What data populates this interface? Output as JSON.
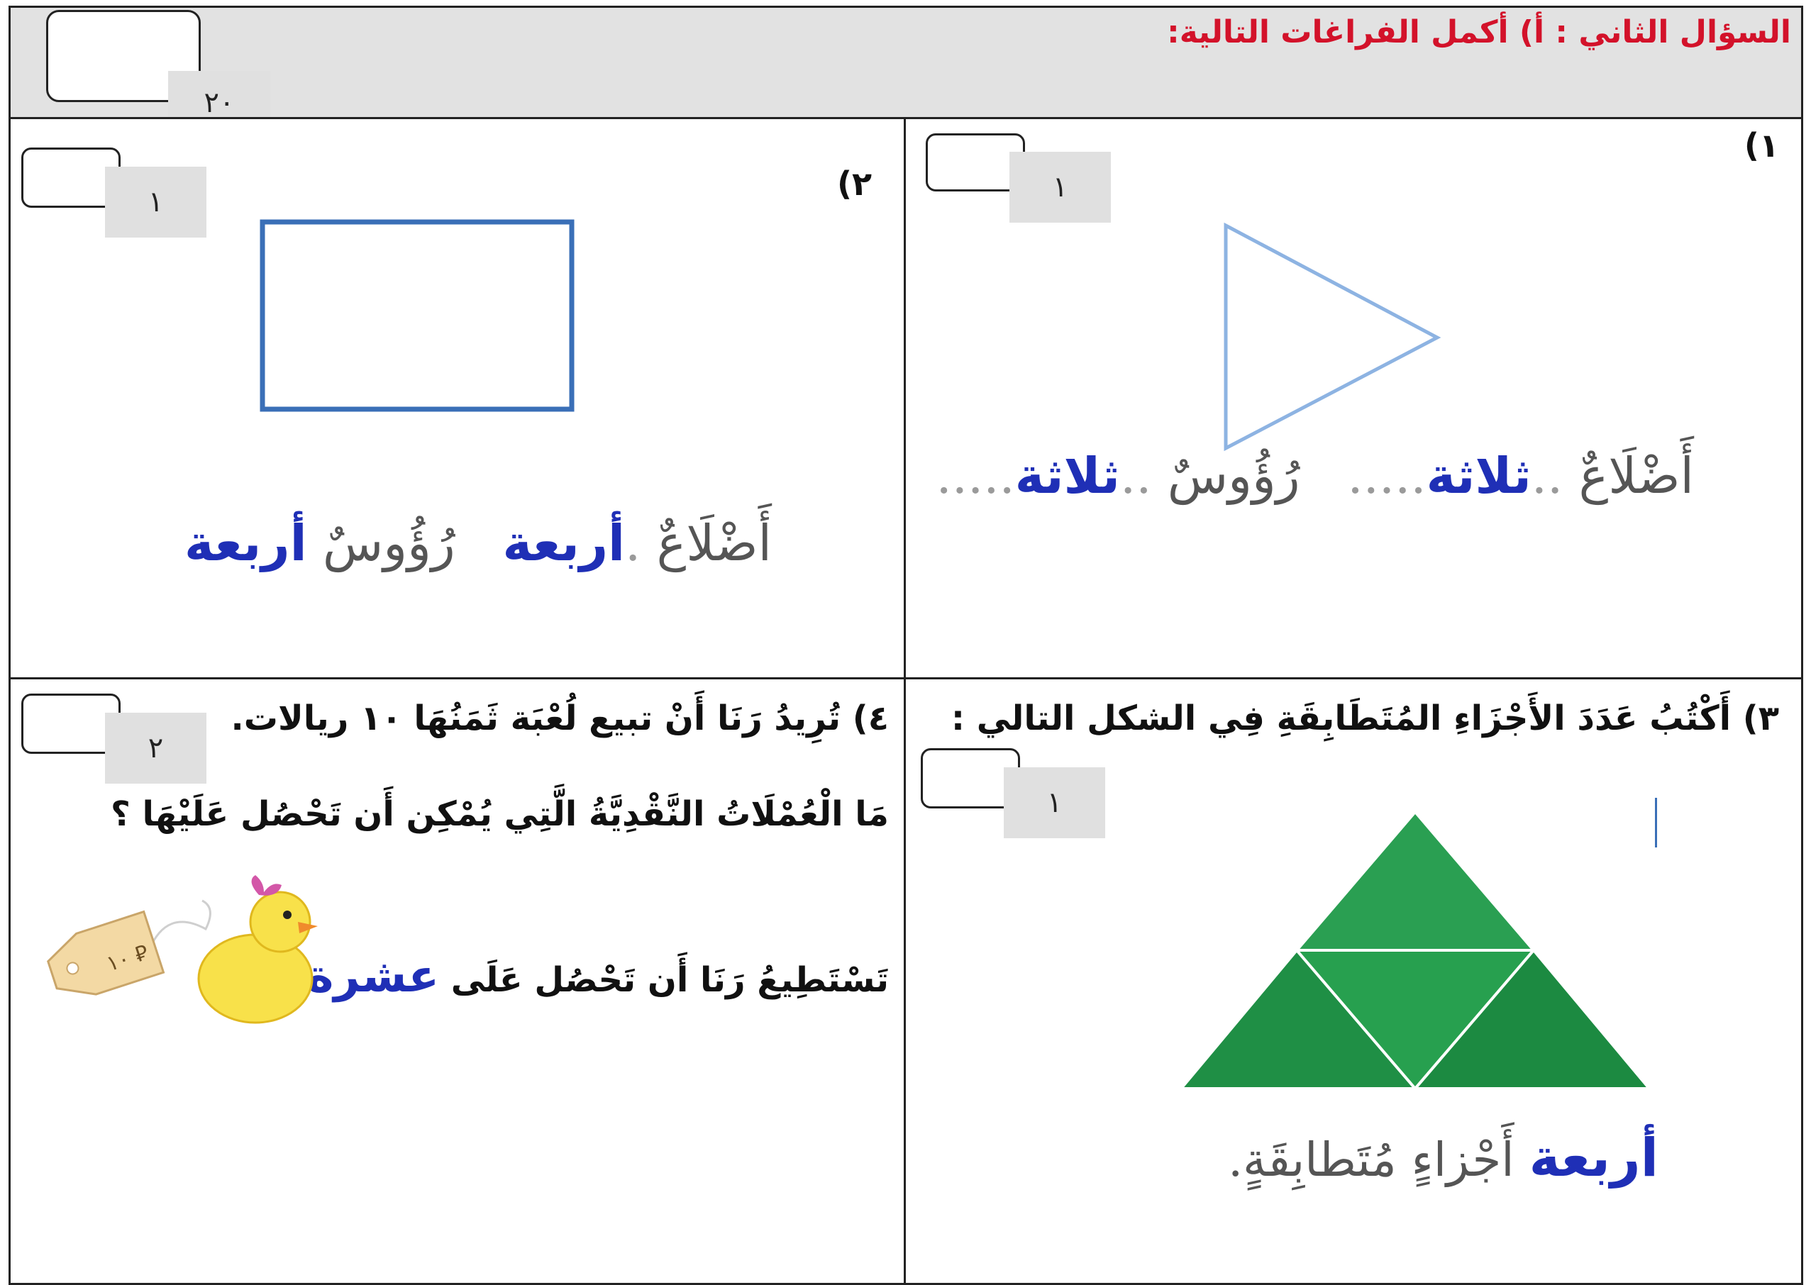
{
  "header": {
    "title": "السؤال الثاني : أ)  أكمل الفراغات التالية:",
    "total_score": "٢٠"
  },
  "q1": {
    "number": "١)",
    "score": "١",
    "sides_label": "أَضْلَاعٌ",
    "sides_answer": "ثلاثة",
    "vertices_label": "رُؤُوسٌ",
    "vertices_answer": "ثلاثة"
  },
  "q2": {
    "number": "٢)",
    "score": "١",
    "sides_label": "أَضْلَاعٌ",
    "sides_answer": "أربعة",
    "vertices_label": "رُؤُوسٌ",
    "vertices_answer": "أربعة"
  },
  "q3": {
    "prompt": "٣) أَكْتُبُ عَدَدَ الأَجْزَاءِ المُتَطَابِقَةِ فِي الشكل التالي :",
    "score": "١",
    "answer": "أربعة",
    "suffix": "أَجْزاءٍ مُتَطابِقَةٍ."
  },
  "q4": {
    "prompt": "٤) تُرِيدُ رَنَا أَنْ تبيع لُعْبَة ثَمَنُهَا ١٠ ريالات.",
    "question": "مَا الْعُمْلَاتُ النَّقْدِيَّةُ الَّتِي يُمْكِن أَن تَحْصُل عَلَيْهَا ؟",
    "answer_prefix": "تَسْتَطِيعُ رَنَا أَن تَحْصُل عَلَى",
    "answer": "عشرة",
    "score": "٢",
    "price_tag": "١٠ ⃁"
  },
  "colors": {
    "title_red": "#d3122a",
    "answer_blue": "#1f2fb6",
    "triangle_stroke": "#8db3e2",
    "rectangle_stroke": "#3a6fb7",
    "green": "#1f9a48"
  }
}
